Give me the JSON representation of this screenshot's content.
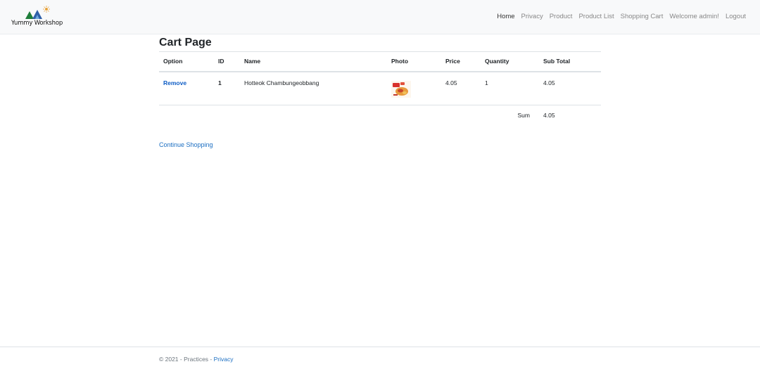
{
  "brand": {
    "name": "Yummy Workshop",
    "icon": "mountain-sun-logo"
  },
  "nav": {
    "items": [
      {
        "label": "Home"
      },
      {
        "label": "Privacy"
      },
      {
        "label": "Product"
      },
      {
        "label": "Product List"
      },
      {
        "label": "Shopping Cart"
      },
      {
        "label": "Welcome admin!"
      },
      {
        "label": "Logout"
      }
    ]
  },
  "page": {
    "title": "Cart Page"
  },
  "cart": {
    "headers": [
      "Option",
      "ID",
      "Name",
      "Photo",
      "Price",
      "Quantity",
      "Sub Total"
    ],
    "items": [
      {
        "option": "Remove",
        "id": "1",
        "name": "Hotteok Chambungeobbang",
        "photo": "product-photo",
        "price": "4.05",
        "quantity": "1",
        "subtotal": "4.05"
      }
    ],
    "sum_label": "Sum",
    "sum_value": "4.05"
  },
  "continue_label": "Continue Shopping",
  "footer": {
    "copyright": "© 2021 - Practices - ",
    "privacy_label": "Privacy"
  },
  "colors": {
    "link": "#1b6ec2",
    "navbar_bg": "#f8f9fa"
  }
}
